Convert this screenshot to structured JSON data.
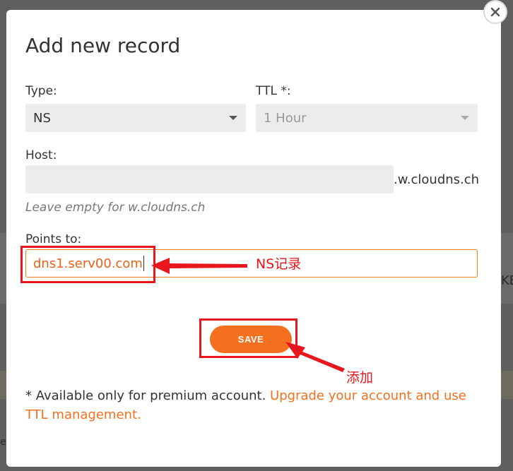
{
  "background": {
    "right_edge_text": "KE",
    "left_edge_text": "e"
  },
  "modal": {
    "title": "Add new record",
    "close_icon": "close-icon"
  },
  "form": {
    "type_label": "Type:",
    "type_value": "NS",
    "ttl_label": "TTL *:",
    "ttl_value": "1 Hour",
    "host_label": "Host:",
    "host_value": "",
    "host_suffix": ".w.cloudns.ch",
    "host_hint": "Leave empty for w.cloudns.ch",
    "points_label": "Points to:",
    "points_value": "dns1.serv00.com",
    "save_label": "SAVE"
  },
  "footer": {
    "note_prefix": "* Available only for premium account. ",
    "note_link": "Upgrade your account and use TTL management."
  },
  "annotations": {
    "points_note": "NS记录",
    "save_note": "添加"
  },
  "colors": {
    "accent": "#f4701f",
    "annotation": "#e8161d",
    "overlay": "#5f5f5f"
  }
}
